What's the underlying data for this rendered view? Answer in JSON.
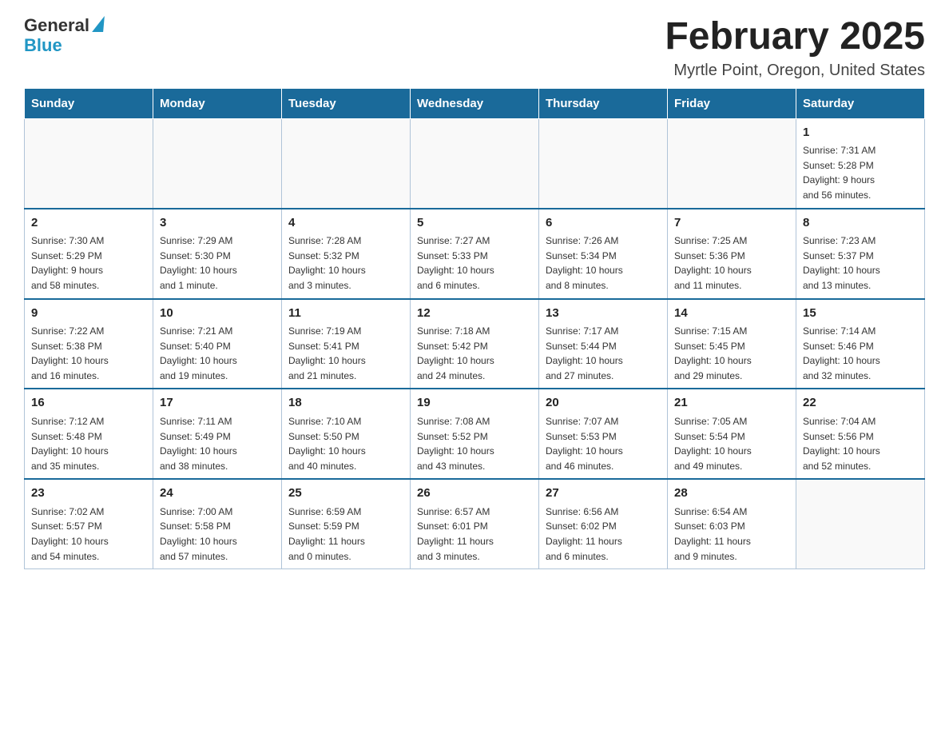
{
  "logo": {
    "text_general": "General",
    "text_blue": "Blue"
  },
  "title": {
    "month": "February 2025",
    "location": "Myrtle Point, Oregon, United States"
  },
  "weekdays": [
    "Sunday",
    "Monday",
    "Tuesday",
    "Wednesday",
    "Thursday",
    "Friday",
    "Saturday"
  ],
  "weeks": [
    [
      {
        "day": "",
        "info": ""
      },
      {
        "day": "",
        "info": ""
      },
      {
        "day": "",
        "info": ""
      },
      {
        "day": "",
        "info": ""
      },
      {
        "day": "",
        "info": ""
      },
      {
        "day": "",
        "info": ""
      },
      {
        "day": "1",
        "info": "Sunrise: 7:31 AM\nSunset: 5:28 PM\nDaylight: 9 hours\nand 56 minutes."
      }
    ],
    [
      {
        "day": "2",
        "info": "Sunrise: 7:30 AM\nSunset: 5:29 PM\nDaylight: 9 hours\nand 58 minutes."
      },
      {
        "day": "3",
        "info": "Sunrise: 7:29 AM\nSunset: 5:30 PM\nDaylight: 10 hours\nand 1 minute."
      },
      {
        "day": "4",
        "info": "Sunrise: 7:28 AM\nSunset: 5:32 PM\nDaylight: 10 hours\nand 3 minutes."
      },
      {
        "day": "5",
        "info": "Sunrise: 7:27 AM\nSunset: 5:33 PM\nDaylight: 10 hours\nand 6 minutes."
      },
      {
        "day": "6",
        "info": "Sunrise: 7:26 AM\nSunset: 5:34 PM\nDaylight: 10 hours\nand 8 minutes."
      },
      {
        "day": "7",
        "info": "Sunrise: 7:25 AM\nSunset: 5:36 PM\nDaylight: 10 hours\nand 11 minutes."
      },
      {
        "day": "8",
        "info": "Sunrise: 7:23 AM\nSunset: 5:37 PM\nDaylight: 10 hours\nand 13 minutes."
      }
    ],
    [
      {
        "day": "9",
        "info": "Sunrise: 7:22 AM\nSunset: 5:38 PM\nDaylight: 10 hours\nand 16 minutes."
      },
      {
        "day": "10",
        "info": "Sunrise: 7:21 AM\nSunset: 5:40 PM\nDaylight: 10 hours\nand 19 minutes."
      },
      {
        "day": "11",
        "info": "Sunrise: 7:19 AM\nSunset: 5:41 PM\nDaylight: 10 hours\nand 21 minutes."
      },
      {
        "day": "12",
        "info": "Sunrise: 7:18 AM\nSunset: 5:42 PM\nDaylight: 10 hours\nand 24 minutes."
      },
      {
        "day": "13",
        "info": "Sunrise: 7:17 AM\nSunset: 5:44 PM\nDaylight: 10 hours\nand 27 minutes."
      },
      {
        "day": "14",
        "info": "Sunrise: 7:15 AM\nSunset: 5:45 PM\nDaylight: 10 hours\nand 29 minutes."
      },
      {
        "day": "15",
        "info": "Sunrise: 7:14 AM\nSunset: 5:46 PM\nDaylight: 10 hours\nand 32 minutes."
      }
    ],
    [
      {
        "day": "16",
        "info": "Sunrise: 7:12 AM\nSunset: 5:48 PM\nDaylight: 10 hours\nand 35 minutes."
      },
      {
        "day": "17",
        "info": "Sunrise: 7:11 AM\nSunset: 5:49 PM\nDaylight: 10 hours\nand 38 minutes."
      },
      {
        "day": "18",
        "info": "Sunrise: 7:10 AM\nSunset: 5:50 PM\nDaylight: 10 hours\nand 40 minutes."
      },
      {
        "day": "19",
        "info": "Sunrise: 7:08 AM\nSunset: 5:52 PM\nDaylight: 10 hours\nand 43 minutes."
      },
      {
        "day": "20",
        "info": "Sunrise: 7:07 AM\nSunset: 5:53 PM\nDaylight: 10 hours\nand 46 minutes."
      },
      {
        "day": "21",
        "info": "Sunrise: 7:05 AM\nSunset: 5:54 PM\nDaylight: 10 hours\nand 49 minutes."
      },
      {
        "day": "22",
        "info": "Sunrise: 7:04 AM\nSunset: 5:56 PM\nDaylight: 10 hours\nand 52 minutes."
      }
    ],
    [
      {
        "day": "23",
        "info": "Sunrise: 7:02 AM\nSunset: 5:57 PM\nDaylight: 10 hours\nand 54 minutes."
      },
      {
        "day": "24",
        "info": "Sunrise: 7:00 AM\nSunset: 5:58 PM\nDaylight: 10 hours\nand 57 minutes."
      },
      {
        "day": "25",
        "info": "Sunrise: 6:59 AM\nSunset: 5:59 PM\nDaylight: 11 hours\nand 0 minutes."
      },
      {
        "day": "26",
        "info": "Sunrise: 6:57 AM\nSunset: 6:01 PM\nDaylight: 11 hours\nand 3 minutes."
      },
      {
        "day": "27",
        "info": "Sunrise: 6:56 AM\nSunset: 6:02 PM\nDaylight: 11 hours\nand 6 minutes."
      },
      {
        "day": "28",
        "info": "Sunrise: 6:54 AM\nSunset: 6:03 PM\nDaylight: 11 hours\nand 9 minutes."
      },
      {
        "day": "",
        "info": ""
      }
    ]
  ]
}
